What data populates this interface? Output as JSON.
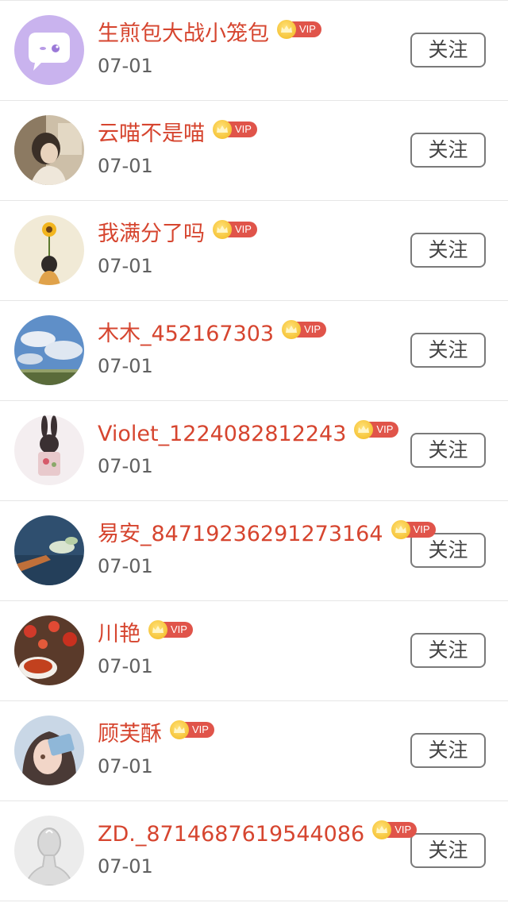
{
  "follow_label": "关注",
  "vip_label": "VIP",
  "colors": {
    "name": "#d6452f",
    "date": "#5f5f5f",
    "vip_tag": "#e0544a",
    "vip_crown": "#f2b71c",
    "button_border": "#7a7a7a",
    "divider": "#e6e6e6"
  },
  "users": [
    {
      "name": "生煎包大战小笼包",
      "date": "07-01",
      "avatar": "purple-chat-icon"
    },
    {
      "name": "云喵不是喵",
      "date": "07-01",
      "avatar": "girl-portrait-photo"
    },
    {
      "name": "我满分了吗",
      "date": "07-01",
      "avatar": "sunflower-girl-illustration"
    },
    {
      "name": "木木_452167303",
      "date": "07-01",
      "avatar": "sky-clouds-photo"
    },
    {
      "name": "Violet_1224082812243",
      "date": "07-01",
      "avatar": "bunny-ears-doll-photo"
    },
    {
      "name": "易安_84719236291273164",
      "date": "07-01",
      "avatar": "hand-with-flower-photo"
    },
    {
      "name": "川艳",
      "date": "07-01",
      "avatar": "red-flowers-tea-photo"
    },
    {
      "name": "顾芙酥",
      "date": "07-01",
      "avatar": "anime-girl-illustration"
    },
    {
      "name": "ZD._8714687619544086",
      "date": "07-01",
      "avatar": "glass-mannequin-photo"
    }
  ]
}
